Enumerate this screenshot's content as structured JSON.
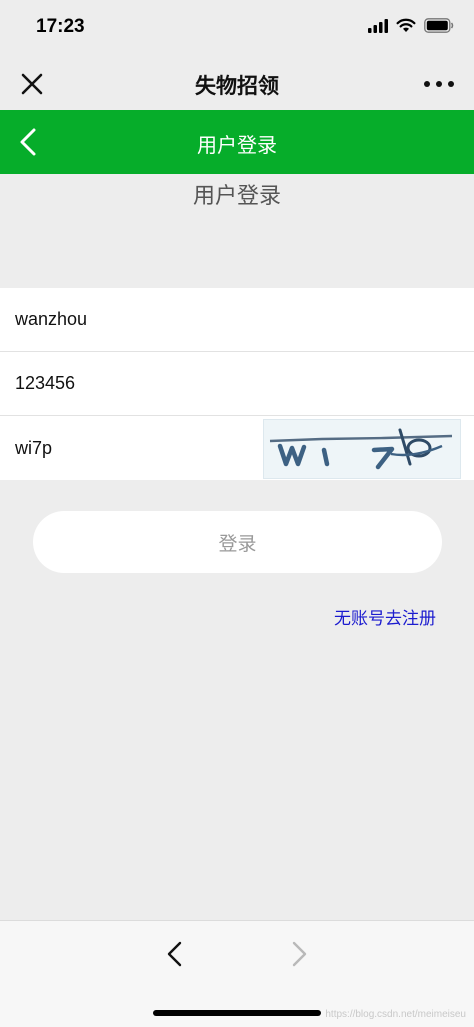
{
  "status_bar": {
    "time": "17:23"
  },
  "wechat_nav": {
    "title": "失物招领"
  },
  "app_header": {
    "title": "用户登录"
  },
  "page": {
    "heading": "用户登录"
  },
  "form": {
    "username_value": "wanzhou",
    "password_value": "123456",
    "captcha_input_value": "wi7p",
    "captcha_image_text": "wi7p"
  },
  "actions": {
    "login_label": "登录",
    "register_link": "无账号去注册"
  },
  "footer": {
    "watermark": "https://blog.csdn.net/meimeiseu"
  },
  "colors": {
    "header_green": "#06ad2a",
    "link_blue": "#1c1ccf",
    "page_background": "#ededed"
  },
  "icons": [
    "close-icon",
    "more-icon",
    "back-arrow-icon",
    "browser-back-icon",
    "browser-forward-icon",
    "signal-icon",
    "wifi-icon",
    "battery-icon"
  ]
}
